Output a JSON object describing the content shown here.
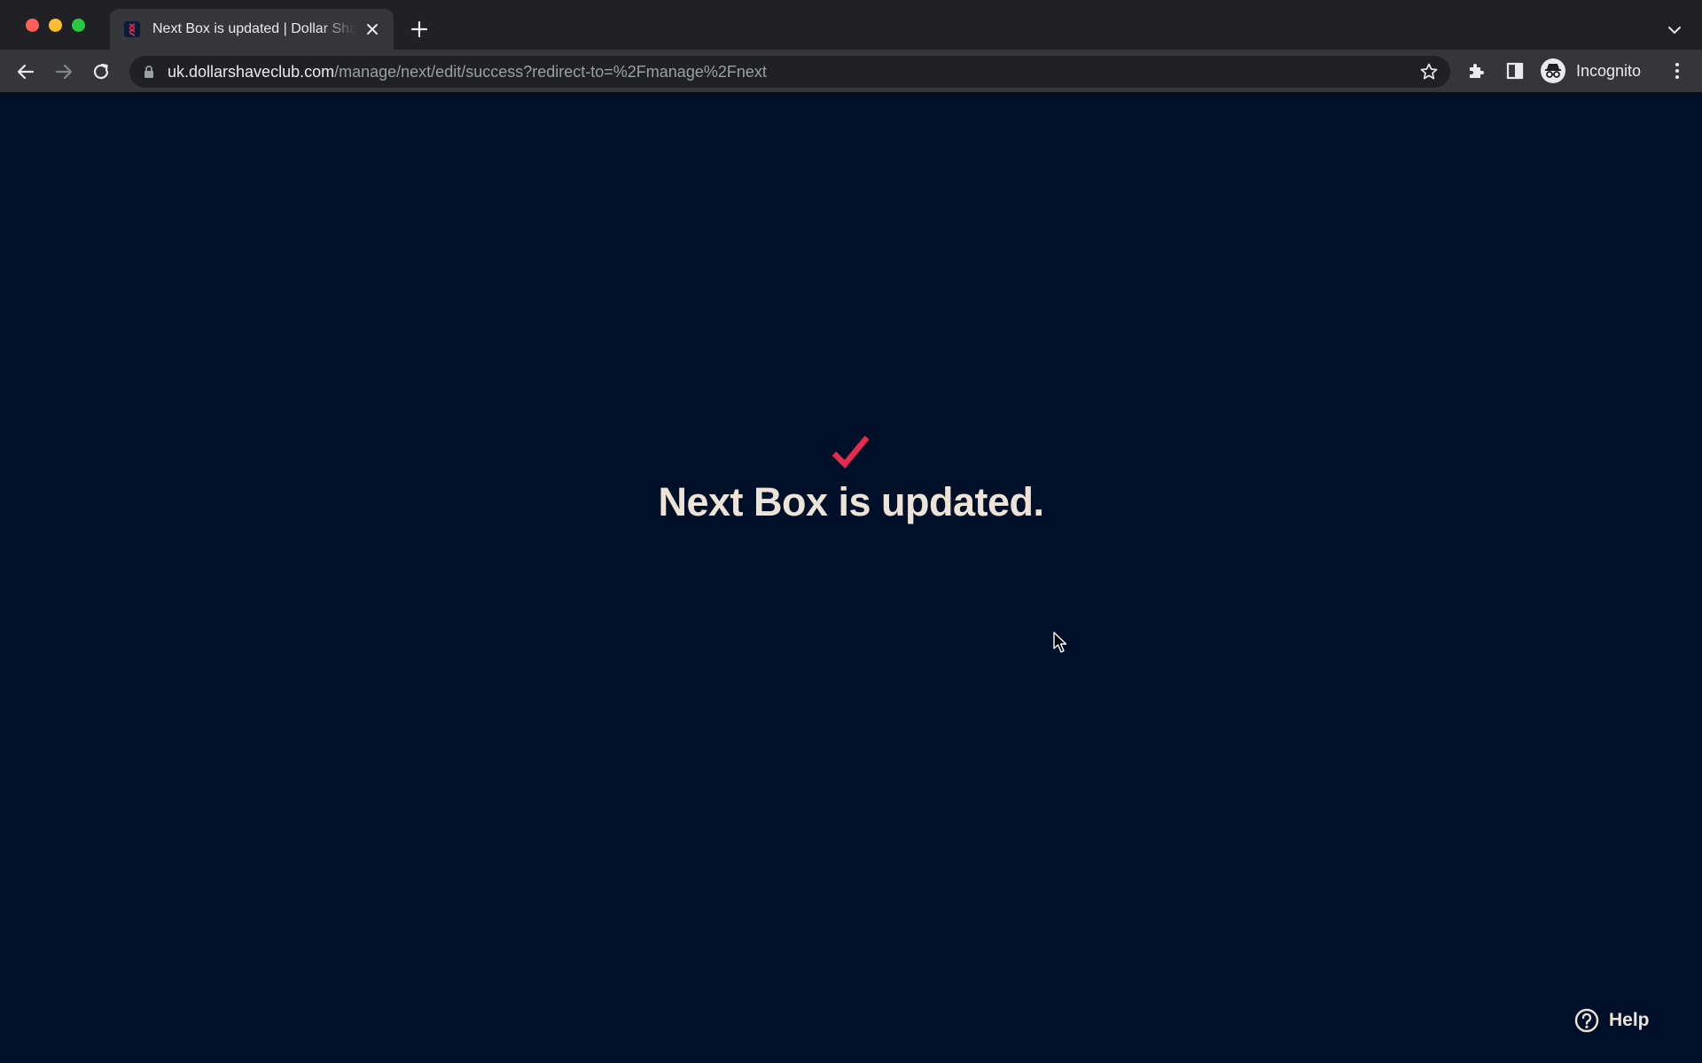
{
  "browser": {
    "tab": {
      "title": "Next Box is updated | Dollar Shave Club",
      "favicon": "dsc-logo-icon"
    },
    "address_bar": {
      "host": "uk.dollarshaveclub.com",
      "path": "/manage/next/edit/success?redirect-to=%2Fmanage%2Fnext"
    },
    "profile": {
      "label": "Incognito",
      "icon": "incognito-icon"
    }
  },
  "page": {
    "background_color": "#011029",
    "accent_color": "#e8294b",
    "text_color": "#ede3d7",
    "success_icon": "checkmark-icon",
    "message": "Next Box is updated.",
    "help_label": "Help",
    "help_icon": "question-circle-icon"
  }
}
